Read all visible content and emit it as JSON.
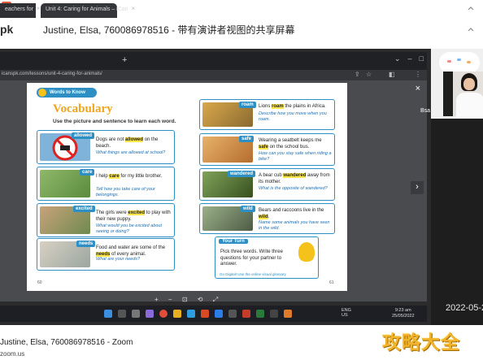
{
  "zoom_header": {
    "left_fragment": "pk",
    "title": "Justine, Elsa, 760086978516 - 带有演讲者视图的共享屏幕"
  },
  "browser": {
    "tabs": [
      {
        "label": "eachers for"
      },
      {
        "label": "Unit 4: Caring for Animals – iCan"
      }
    ],
    "new_tab": "+",
    "url": "icanspk.com/lessons/unit-4-caring-for-animals/"
  },
  "viewer": {
    "close": "×",
    "next": "›"
  },
  "page": {
    "badge": "Words to Know",
    "heading": "Vocabulary",
    "instruction": "Use the picture and sentence to learn each word.",
    "page_left": "60",
    "page_right": "61"
  },
  "vocab_left": [
    {
      "word": "allowed",
      "before": "Dogs are not ",
      "after": " on the beach.",
      "question": "What things are allowed at school?"
    },
    {
      "word": "care",
      "before": "I help ",
      "after": " for my little brother.",
      "question": "Tell how you take care of your belongings."
    },
    {
      "word": "excited",
      "before": "The girls were ",
      "after": " to play with their new puppy.",
      "question": "What would you be excited about seeing or doing?"
    },
    {
      "word": "needs",
      "before": "Food and water are some of the ",
      "after": " of every animal.",
      "question": "What are your needs?"
    }
  ],
  "vocab_right": [
    {
      "tag": "roam",
      "word": "roam",
      "before": "Lions ",
      "after": " the plains in Africa.",
      "question": "Describe how you move when you roam."
    },
    {
      "tag": "safe",
      "word": "safe",
      "before": "Wearing a seatbelt keeps me ",
      "after": " on the school bus.",
      "question": "How can you stay safe when riding a bike?"
    },
    {
      "tag": "wandered",
      "word": "wandered",
      "before": "A bear cub ",
      "after": " away from its mother.",
      "question": "What is the opposite of wandered?"
    },
    {
      "tag": "wild",
      "word": "wild",
      "before": "Bears and raccoons live in the ",
      "after": ".",
      "question": "Name some animals you have seen in the wild."
    }
  ],
  "your_turn": {
    "title": "Your Turn",
    "text": "Pick three words. Write three questions for your partner to answer.",
    "footer": "Go Digital!  Use the online visual glossary"
  },
  "pdf_toolbar": [
    "+",
    "−",
    "⊡",
    "⟲",
    "⤢"
  ],
  "taskbar": {
    "lang1": "ENG",
    "lang2": "US",
    "time": "9:23 am",
    "date": "25/05/2022"
  },
  "zoom_side": {
    "name": "Bsa",
    "timestamp": "2022-05-2"
  },
  "zoom_footer": {
    "title": "Justine, Elsa, 760086978516 - Zoom",
    "domain": "zoom.us"
  },
  "watermark": "攻略大全",
  "colors": {
    "accent_blue": "#2d8fc4",
    "heading_orange": "#f1a51d",
    "highlight_yellow": "#fbe64c"
  }
}
